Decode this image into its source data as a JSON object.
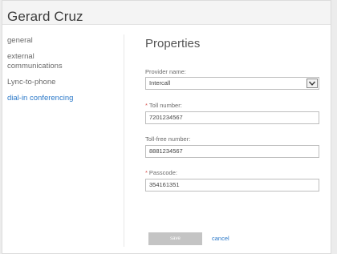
{
  "window": {
    "title": "Gerard Cruz"
  },
  "nav": {
    "items": [
      {
        "label": "general"
      },
      {
        "label": "external communications"
      },
      {
        "label": "Lync-to-phone"
      },
      {
        "label": "dial-in conferencing"
      }
    ],
    "active": "dial-in conferencing"
  },
  "properties": {
    "title": "Properties",
    "provider_label": "Provider name:",
    "provider_value": "Intercall",
    "toll_required_mark": "*",
    "toll_label": "Toll number:",
    "toll_value": "7201234567",
    "toll_free_label": "Toll-free number:",
    "toll_free_value": "8881234567",
    "passcode_required_mark": "*",
    "passcode_label": "Passcode:",
    "passcode_value": "354161351"
  },
  "actions": {
    "save_label": "save",
    "cancel_label": "cancel"
  },
  "colors": {
    "accent": "#2a78c8",
    "required": "#d9534f",
    "disabled_button": "#c4c4c4"
  },
  "icons": {
    "select_arrow": "chevron-down-icon"
  }
}
